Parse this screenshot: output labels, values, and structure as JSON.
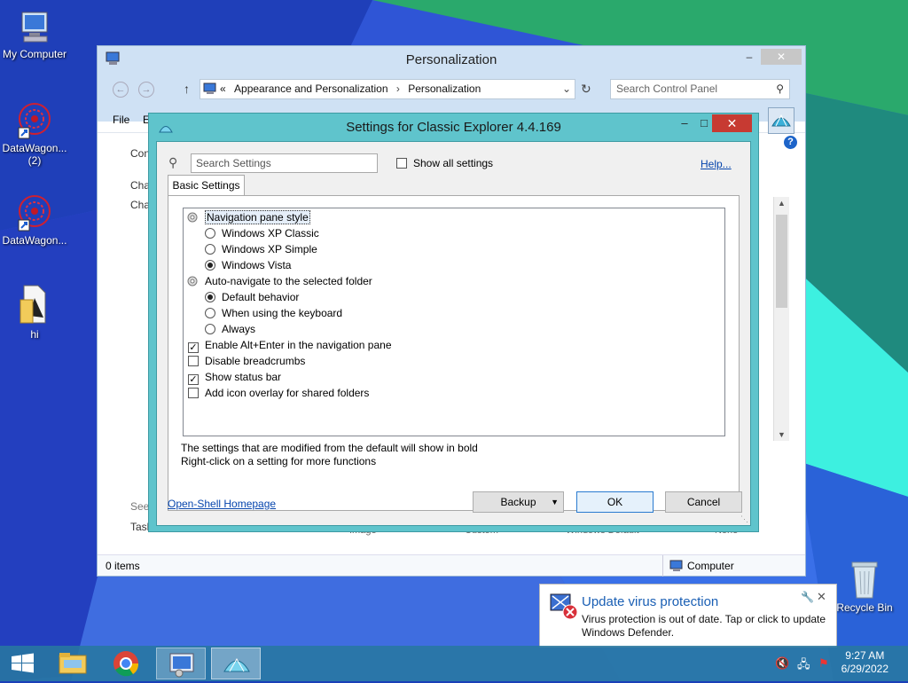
{
  "desktop": {
    "icons": [
      {
        "label": "My Computer"
      },
      {
        "label": "DataWagon...",
        "sublabel": "(2)"
      },
      {
        "label": "DataWagon..."
      },
      {
        "label": "hi"
      },
      {
        "label": "Recycle Bin"
      }
    ]
  },
  "explorer": {
    "title": "Personalization",
    "breadcrumb": {
      "prefix": "«",
      "items": [
        "Appearance and Personalization",
        "Personalization"
      ]
    },
    "search_placeholder": "Search Control Panel",
    "menu": {
      "file": "File",
      "edit": "E"
    },
    "left_fragments": [
      "Con",
      "Cha",
      "Cha",
      "See",
      "Task"
    ],
    "bottom_fragments": [
      "Image",
      "Custom",
      "Windows Default",
      "None"
    ],
    "status_left": "0 items",
    "status_right": "Computer"
  },
  "dialog": {
    "title": "Settings for Classic Explorer 4.4.169",
    "search_placeholder": "Search Settings",
    "show_all_label": "Show all settings",
    "help_link": "Help...",
    "tab": "Basic Settings",
    "settings": {
      "nav_group": "Navigation pane style",
      "nav_options": [
        "Windows XP Classic",
        "Windows XP Simple",
        "Windows Vista"
      ],
      "nav_selected": 2,
      "auto_group": "Auto-navigate to the selected folder",
      "auto_options": [
        "Default behavior",
        "When using the keyboard",
        "Always"
      ],
      "auto_selected": 0,
      "checks": [
        {
          "label": "Enable Alt+Enter in the navigation pane",
          "checked": true
        },
        {
          "label": "Disable breadcrumbs",
          "checked": false
        },
        {
          "label": "Show status bar",
          "checked": true
        },
        {
          "label": "Add icon overlay for shared folders",
          "checked": false
        }
      ]
    },
    "note1": "The settings that are modified from the default will show in bold",
    "note2": "Right-click on a setting for more functions",
    "homepage_link": "Open-Shell Homepage",
    "buttons": {
      "backup": "Backup",
      "ok": "OK",
      "cancel": "Cancel"
    }
  },
  "toast": {
    "title": "Update virus protection",
    "body_line1": "Virus protection is out of date. Tap or click to update",
    "body_line2": "Windows Defender."
  },
  "taskbar": {
    "time": "9:27 AM",
    "date": "6/29/2022"
  },
  "colors": {
    "dialog_frame": "#5fc4cc",
    "close_red": "#c73a32",
    "link_blue": "#0645ad",
    "toast_title": "#1a5fb4"
  }
}
